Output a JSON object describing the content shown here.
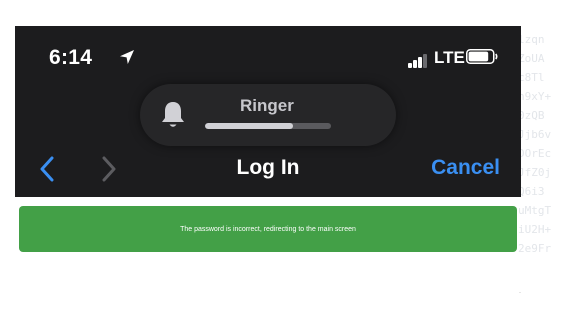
{
  "background_noise": [
    "lzqn",
    "ZoUA",
    "c8Tl",
    "n9xY+",
    "0zQB",
    "Jjb6v",
    "DOrEc",
    "JfZ0j",
    "Q6i3",
    "uMtgT",
    "iU2H+",
    "2e9Fr"
  ],
  "status_bar": {
    "time": "6:14",
    "network": "LTE",
    "location_icon": "location-arrow-icon",
    "signal_icon": "cellular-signal-icon",
    "battery_icon": "battery-icon",
    "signal_bars_active": 3,
    "battery_level": 0.85
  },
  "ringer": {
    "label": "Ringer",
    "icon": "bell-icon",
    "level": 0.7
  },
  "nav": {
    "title": "Log In",
    "cancel_label": "Cancel",
    "back_icon": "chevron-left-icon",
    "forward_icon": "chevron-right-icon"
  },
  "toast": {
    "message": "The password is incorrect, redirecting to the main screen",
    "color": "#43a047"
  },
  "colors": {
    "accent": "#3a8ff2",
    "dark_background": "#1c1c1e"
  }
}
